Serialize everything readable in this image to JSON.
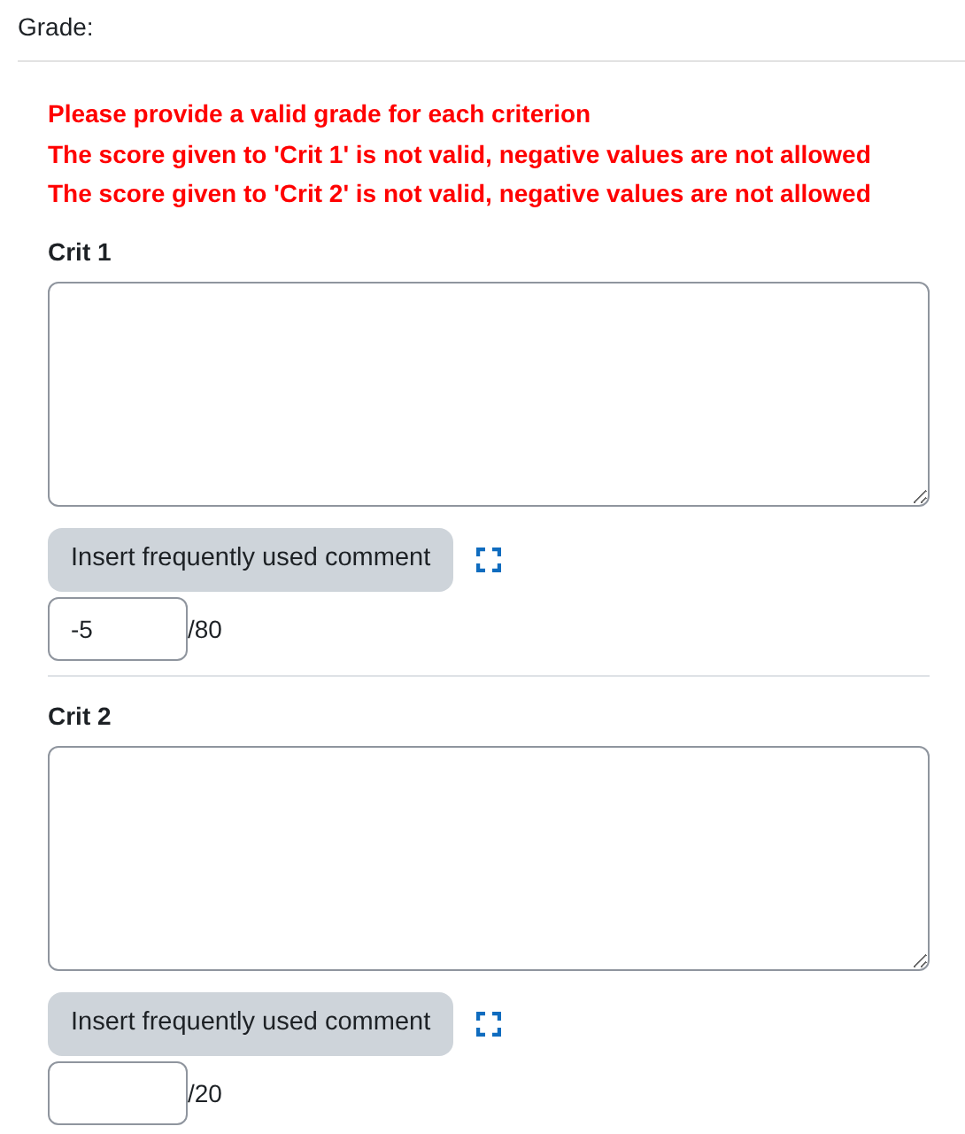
{
  "grade_label": "Grade:",
  "errors": [
    "Please provide a valid grade for each criterion",
    "The score given to 'Crit 1' is not valid, negative values are not allowed",
    "The score given to 'Crit 2' is not valid, negative values are not allowed"
  ],
  "criteria": [
    {
      "name": "Crit 1",
      "comment_button": "Insert frequently used comment",
      "score": "-5",
      "max": "/80"
    },
    {
      "name": "Crit 2",
      "comment_button": "Insert frequently used comment",
      "max": "/20"
    }
  ]
}
